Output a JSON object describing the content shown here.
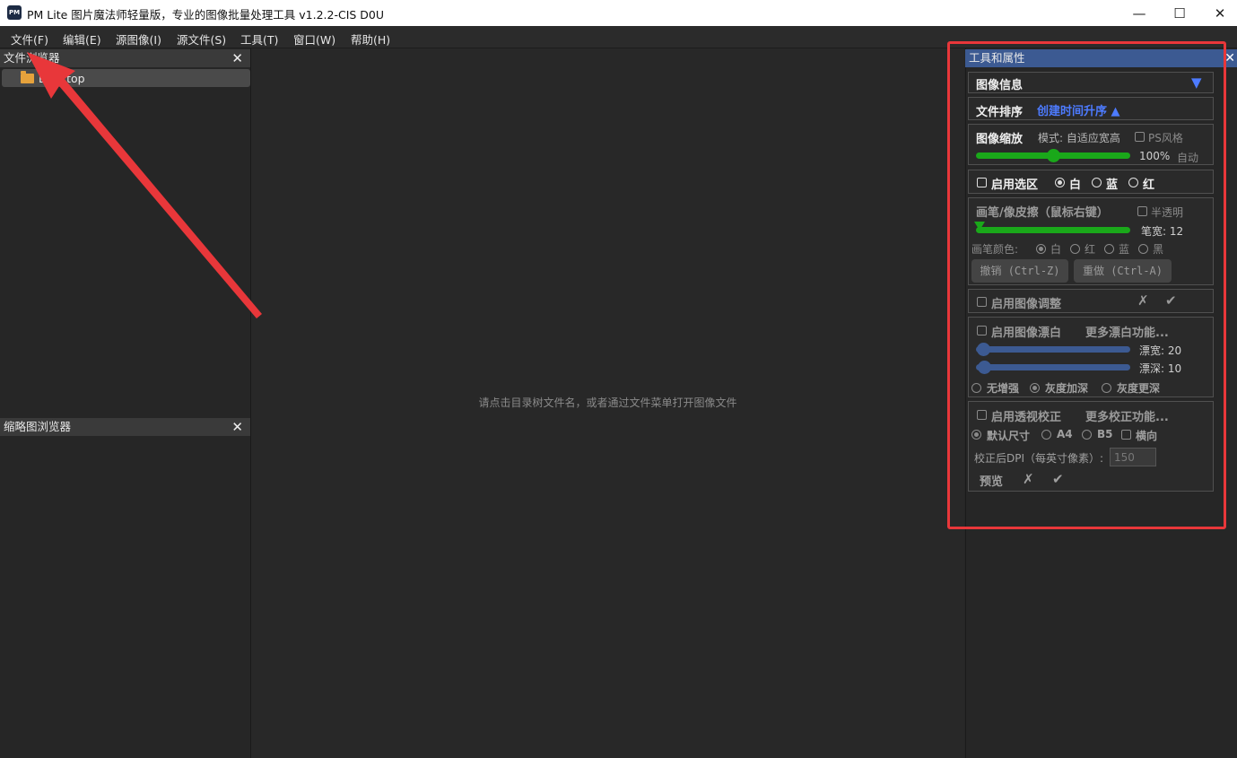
{
  "window": {
    "logo_text": "PM",
    "title": "PM Lite 图片魔法师轻量版，专业的图像批量处理工具 v1.2.2-CIS D0U",
    "minimize": "—",
    "maximize": "☐",
    "close": "✕"
  },
  "menu": [
    "文件(F)",
    "编辑(E)",
    "源图像(I)",
    "源文件(S)",
    "工具(T)",
    "窗口(W)",
    "帮助(H)"
  ],
  "file_browser": {
    "title": "文件浏览器",
    "close": "✕",
    "item_label": "Desktop"
  },
  "thumb_browser": {
    "title": "缩略图浏览器",
    "close": "✕"
  },
  "center": {
    "hint": "请点击目录树文件名，或者通过文件菜单打开图像文件"
  },
  "tools": {
    "title": "工具和属性",
    "close": "✕",
    "image_info": {
      "label": "图像信息",
      "toggle": "▼"
    },
    "sort": {
      "label": "文件排序",
      "value": "创建时间升序 ▲"
    },
    "zoom": {
      "label": "图像缩放",
      "mode": "模式: 自适应宽高",
      "ps_style": "PS风格",
      "percent": "100%",
      "auto": "自动",
      "level": 0.5
    },
    "selection": {
      "enable": "启用选区",
      "options": [
        "白",
        "蓝",
        "红"
      ],
      "selected": "白"
    },
    "brush": {
      "label": "画笔/像皮擦（鼠标右键）",
      "semi_transparent": "半透明",
      "width_label": "笔宽: 12",
      "color_label": "画笔颜色:",
      "colors": [
        "白",
        "红",
        "蓝",
        "黑"
      ],
      "undo": "撤销 (Ctrl-Z)",
      "redo": "重做 (Ctrl-A)",
      "level": 0.0
    },
    "adjust": {
      "enable": "启用图像调整",
      "cancel": "✗",
      "confirm": "✔"
    },
    "whiten": {
      "enable": "启用图像漂白",
      "more": "更多漂白功能...",
      "width_label": "漂宽: 20",
      "depth_label": "漂深: 10",
      "options": [
        "无增强",
        "灰度加深",
        "灰度更深"
      ],
      "selected": "灰度加深"
    },
    "perspective": {
      "enable": "启用透视校正",
      "more": "更多校正功能...",
      "sizes": [
        "默认尺寸",
        "A4",
        "B5"
      ],
      "landscape": "横向",
      "dpi_label": "校正后DPI（每英寸像素）:",
      "dpi_value": "150",
      "preview": "预览",
      "cancel": "✗",
      "confirm": "✔"
    }
  },
  "colors": {
    "accent_blue": "#4d7bff",
    "slider_green": "#1aa81a",
    "slider_blue": "#3c5a92",
    "annotation_red": "#e8373a"
  }
}
